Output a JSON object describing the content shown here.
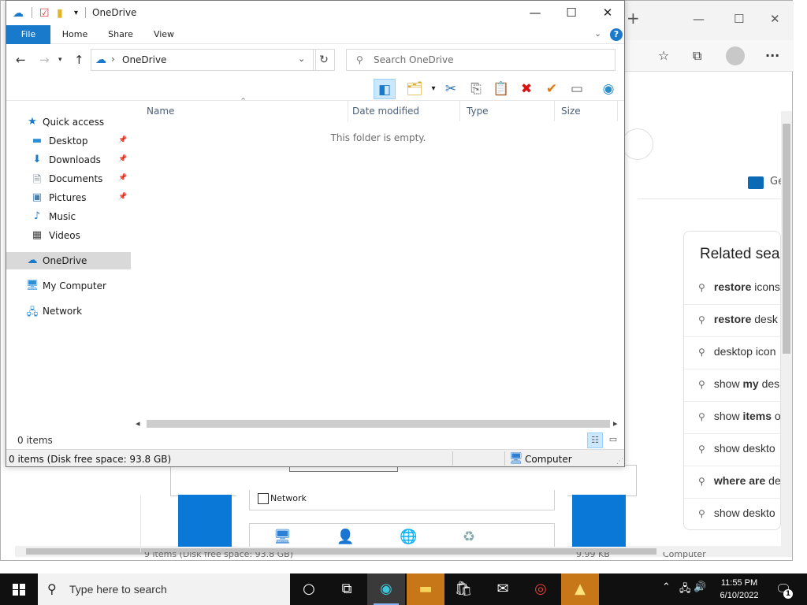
{
  "explorer": {
    "title": "OneDrive",
    "ribbon": {
      "file": "File",
      "home": "Home",
      "share": "Share",
      "view": "View",
      "help": "?"
    },
    "address": {
      "location": "OneDrive"
    },
    "search": {
      "placeholder": "Search OneDrive"
    },
    "nav": {
      "quick_access": "Quick access",
      "items": [
        {
          "label": "Desktop",
          "icon": "desktop-icon",
          "pinned": true
        },
        {
          "label": "Downloads",
          "icon": "downloads-icon",
          "pinned": true
        },
        {
          "label": "Documents",
          "icon": "documents-icon",
          "pinned": true
        },
        {
          "label": "Pictures",
          "icon": "pictures-icon",
          "pinned": true
        },
        {
          "label": "Music",
          "icon": "music-icon",
          "pinned": false
        },
        {
          "label": "Videos",
          "icon": "videos-icon",
          "pinned": false
        }
      ],
      "onedrive": "OneDrive",
      "my_computer": "My Computer",
      "network": "Network"
    },
    "columns": [
      "Name",
      "Date modified",
      "Type",
      "Size"
    ],
    "empty_message": "This folder is empty.",
    "item_count": "0 items",
    "status": {
      "left": "0 items (Disk free space: 93.8 GB)",
      "right": "Computer"
    }
  },
  "browser": {
    "related_title": "Related sea",
    "related_items": [
      {
        "bold": "restore",
        "rest": " icons"
      },
      {
        "bold": "restore",
        "rest": " desk"
      },
      {
        "bold": "",
        "rest": "desktop icon"
      },
      {
        "bold": "my",
        "pre": "show ",
        "rest": " des"
      },
      {
        "bold": "items",
        "pre": "show ",
        "rest": " o"
      },
      {
        "bold": "",
        "rest": "show deskto"
      },
      {
        "bold": "where are",
        "rest": " de"
      },
      {
        "bold": "",
        "rest": "show deskto"
      }
    ],
    "ge_text": "Ge",
    "status_strip": "9 items (Disk free space: 93.8 GB)",
    "status_size": "9.99 KB",
    "status_computer": "Computer"
  },
  "bg_dialog": {
    "network_label": "Network"
  },
  "taskbar": {
    "search_placeholder": "Type here to search",
    "time": "11:55 PM",
    "date": "6/10/2022",
    "notification_count": "1"
  },
  "colors": {
    "accent": "#1979ca",
    "selection": "#d9d9d9",
    "taskbar": "#101010"
  }
}
